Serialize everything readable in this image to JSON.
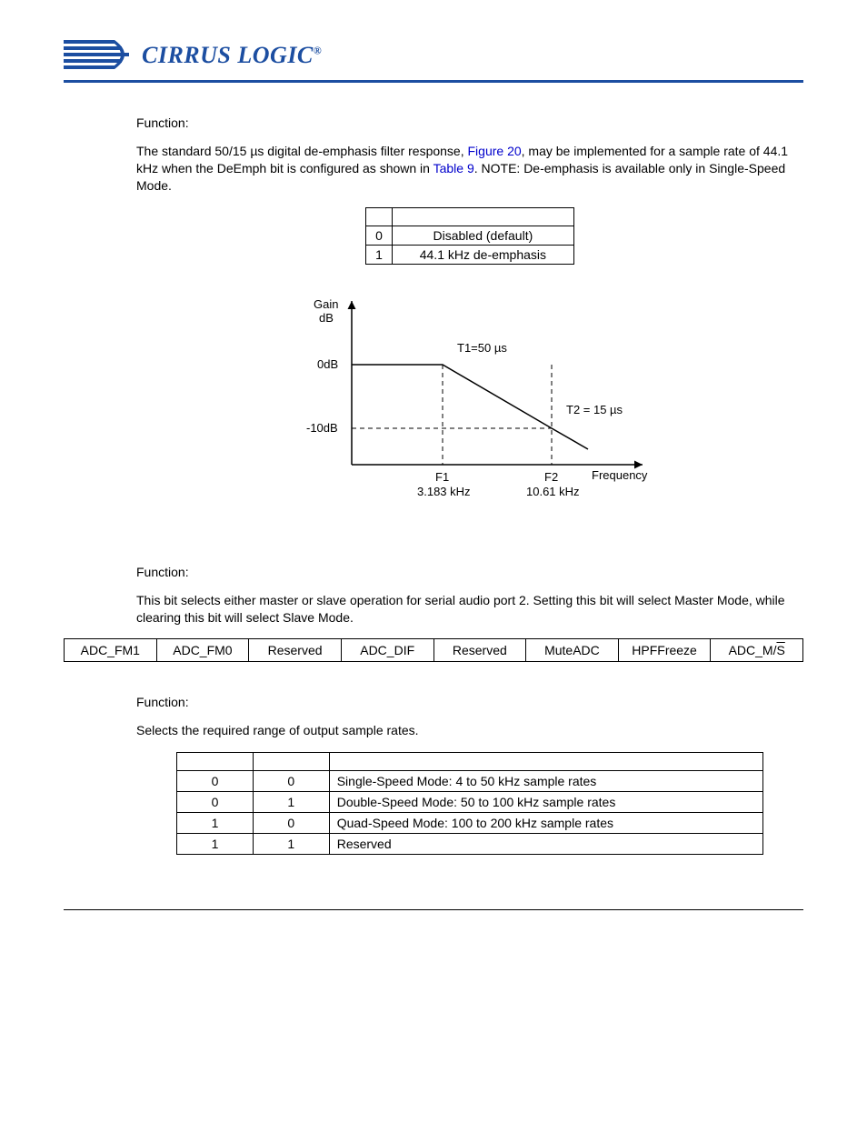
{
  "logo": {
    "text": "CIRRUS LOGIC",
    "reg": "®"
  },
  "section1": {
    "func_label": "Function:",
    "para_pre": "The standard 50/15 ",
    "para_mu": "µ",
    "para_mid1": "s digital de-emphasis filter response, ",
    "link1": "Figure 20",
    "para_mid2": ", may be implemented for a sample rate of 44.1 kHz when the DeEmph bit is configured as shown in ",
    "link2": "Table 9",
    "para_end": ". NOTE: De-emphasis is available only in Single-Speed Mode.",
    "table": {
      "rows": [
        {
          "v": "0",
          "d": "Disabled (default)"
        },
        {
          "v": "1",
          "d": "44.1 kHz de-emphasis"
        }
      ]
    }
  },
  "chart_data": {
    "type": "line",
    "title": "",
    "xlabel": "Frequency",
    "ylabel_top": "Gain",
    "ylabel_bot": "dB",
    "y_ticks": [
      "0dB",
      "-10dB"
    ],
    "x_ticks": [
      {
        "label": "F1",
        "sub": "3.183 kHz"
      },
      {
        "label": "F2",
        "sub": "10.61 kHz"
      }
    ],
    "annotations": {
      "t1": "T1=50 µs",
      "t2": "T2 = 15 µs"
    },
    "segments": [
      {
        "from": "start",
        "to": "F1",
        "gain_db": 0
      },
      {
        "from": "F1",
        "to": "F2",
        "gain_db_start": 0,
        "gain_db_end": -10
      },
      {
        "from": "F2",
        "to": "end",
        "gain_db": -10,
        "style": "continue-slope"
      }
    ]
  },
  "section2": {
    "func_label": "Function:",
    "para": "This bit selects either master or slave operation for serial audio port 2. Setting this bit will select Master Mode, while clearing this bit will select Slave Mode."
  },
  "bits": [
    "ADC_FM1",
    "ADC_FM0",
    "Reserved",
    "ADC_DIF",
    "Reserved",
    "MuteADC",
    "HPFFreeze"
  ],
  "bits_last": {
    "prefix": "ADC_M/",
    "over": "S"
  },
  "section3": {
    "func_label": "Function:",
    "para": "Selects the required range of output sample rates.",
    "table": {
      "rows": [
        {
          "a": "0",
          "b": "0",
          "d": "Single-Speed Mode: 4 to 50 kHz sample rates"
        },
        {
          "a": "0",
          "b": "1",
          "d": "Double-Speed Mode: 50 to 100 kHz sample rates"
        },
        {
          "a": "1",
          "b": "0",
          "d": "Quad-Speed Mode: 100 to 200 kHz sample rates"
        },
        {
          "a": "1",
          "b": "1",
          "d": "Reserved"
        }
      ]
    }
  }
}
